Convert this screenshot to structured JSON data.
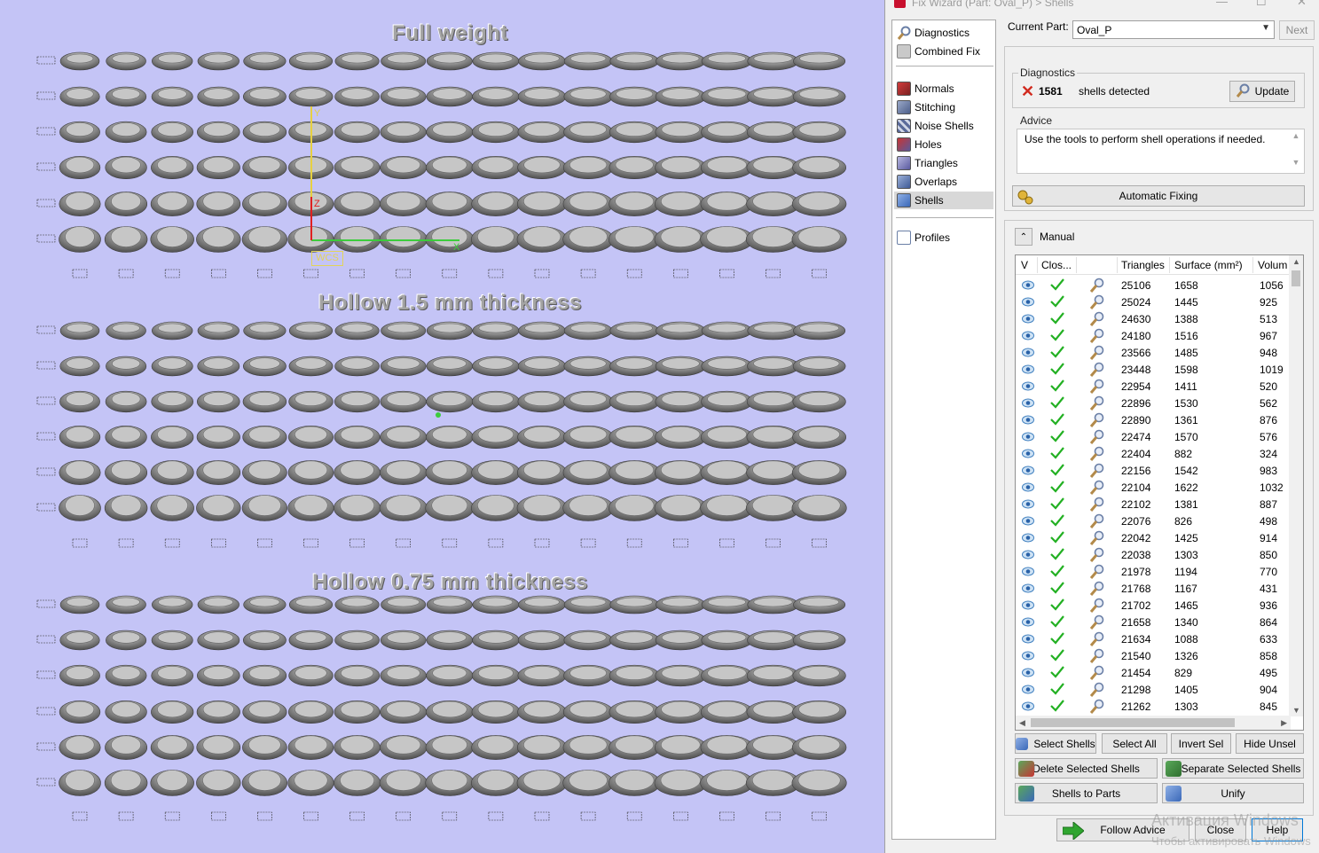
{
  "viewport": {
    "section_titles": [
      "Full weight",
      "Hollow 1.5 mm thickness",
      "Hollow 0.75 mm thickness"
    ],
    "wcs_label": "WCS",
    "axis_labels": {
      "x": "X",
      "y": "Y",
      "z": "Z"
    },
    "colors": {
      "background": "#c4c4f6",
      "ring": "#8a8a8a",
      "x_axis": "#3ccc3c",
      "y_axis": "#e6d040",
      "z_axis": "#e02020"
    }
  },
  "dialog": {
    "title": "Fix Wizard (Part: Oval_P) > Shells",
    "window_controls": {
      "minimize": "—",
      "maximize": "☐",
      "close": "✕"
    },
    "nav": [
      {
        "label": "Diagnostics",
        "icon": "magnifier-icon"
      },
      {
        "label": "Combined Fix",
        "icon": "cube-icon"
      },
      {
        "label": "Normals",
        "icon": "normals-cube-icon"
      },
      {
        "label": "Stitching",
        "icon": "stitching-cube-icon"
      },
      {
        "label": "Noise Shells",
        "icon": "noise-shells-icon"
      },
      {
        "label": "Holes",
        "icon": "holes-cube-icon"
      },
      {
        "label": "Triangles",
        "icon": "triangles-cube-icon"
      },
      {
        "label": "Overlaps",
        "icon": "overlaps-cube-icon"
      },
      {
        "label": "Shells",
        "icon": "shells-cube-icon",
        "selected": true
      },
      {
        "label": "Profiles",
        "icon": "profiles-page-icon"
      }
    ],
    "current_part_label": "Current Part:",
    "current_part_value": "Oval_P",
    "next_button": "Next",
    "diagnostics": {
      "group_label": "Diagnostics",
      "count": "1581",
      "text": "shells detected",
      "update_button": "Update"
    },
    "advice": {
      "group_label": "Advice",
      "text": "Use the tools to perform shell operations if needed.",
      "auto_fix_button": "Automatic Fixing"
    },
    "manual": {
      "label": "Manual",
      "columns": [
        "V",
        "Clos...",
        "",
        "Triangles",
        "Surface (mm²)",
        "Volum"
      ],
      "rows": [
        [
          "25106",
          "1658",
          "1056"
        ],
        [
          "25024",
          "1445",
          "925"
        ],
        [
          "24630",
          "1388",
          "513"
        ],
        [
          "24180",
          "1516",
          "967"
        ],
        [
          "23566",
          "1485",
          "948"
        ],
        [
          "23448",
          "1598",
          "1019"
        ],
        [
          "22954",
          "1411",
          "520"
        ],
        [
          "22896",
          "1530",
          "562"
        ],
        [
          "22890",
          "1361",
          "876"
        ],
        [
          "22474",
          "1570",
          "576"
        ],
        [
          "22404",
          "882",
          "324"
        ],
        [
          "22156",
          "1542",
          "983"
        ],
        [
          "22104",
          "1622",
          "1032"
        ],
        [
          "22102",
          "1381",
          "887"
        ],
        [
          "22076",
          "826",
          "498"
        ],
        [
          "22042",
          "1425",
          "914"
        ],
        [
          "22038",
          "1303",
          "850"
        ],
        [
          "21978",
          "1194",
          "770"
        ],
        [
          "21768",
          "1167",
          "431"
        ],
        [
          "21702",
          "1465",
          "936"
        ],
        [
          "21658",
          "1340",
          "864"
        ],
        [
          "21634",
          "1088",
          "633"
        ],
        [
          "21540",
          "1326",
          "858"
        ],
        [
          "21454",
          "829",
          "495"
        ],
        [
          "21298",
          "1405",
          "904"
        ],
        [
          "21262",
          "1303",
          "845"
        ]
      ],
      "buttons": {
        "select_shells": "Select Shells",
        "select_all": "Select All",
        "invert_sel": "Invert Sel",
        "hide_unsel": "Hide Unsel",
        "delete_selected": "Delete Selected Shells",
        "separate_selected": "Separate Selected Shells",
        "shells_to_parts": "Shells to Parts",
        "unify": "Unify"
      }
    },
    "footer": {
      "follow_advice": "Follow Advice",
      "close": "Close",
      "help": "Help"
    },
    "watermark": {
      "line1": "Активация Windows",
      "line2": "Чтобы активировать Windows"
    }
  }
}
